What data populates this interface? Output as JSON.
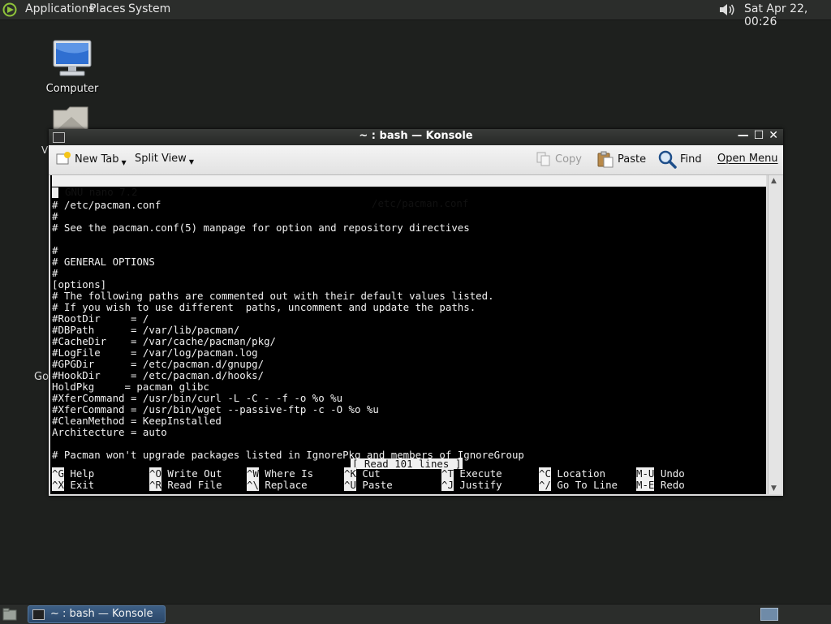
{
  "top_panel": {
    "menus": [
      "Applications",
      "Places",
      "System"
    ],
    "clock": "Sat Apr 22, 00:26"
  },
  "desktop": {
    "icons": [
      {
        "label": "Computer",
        "icon": "computer-icon"
      },
      {
        "label": "",
        "icon": "folder-icon"
      }
    ],
    "partial_labels": [
      "V",
      "Go"
    ]
  },
  "konsole": {
    "title": "~ : bash — Konsole",
    "toolbar": {
      "new_tab": "New Tab",
      "split_view": "Split View",
      "copy": "Copy",
      "paste": "Paste",
      "find": "Find",
      "open_menu": "Open Menu"
    },
    "nano": {
      "version": "GNU nano 7.2",
      "filename": "/etc/pacman.conf",
      "lines": [
        "#",
        "# /etc/pacman.conf",
        "#",
        "# See the pacman.conf(5) manpage for option and repository directives",
        "",
        "#",
        "# GENERAL OPTIONS",
        "#",
        "[options]",
        "# The following paths are commented out with their default values listed.",
        "# If you wish to use different  paths, uncomment and update the paths.",
        "#RootDir     = /",
        "#DBPath      = /var/lib/pacman/",
        "#CacheDir    = /var/cache/pacman/pkg/",
        "#LogFile     = /var/log/pacman.log",
        "#GPGDir      = /etc/pacman.d/gnupg/",
        "#HookDir     = /etc/pacman.d/hooks/",
        "HoldPkg     = pacman glibc",
        "#XferCommand = /usr/bin/curl -L -C - -f -o %o %u",
        "#XferCommand = /usr/bin/wget --passive-ftp -c -O %o %u",
        "#CleanMethod = KeepInstalled",
        "Architecture = auto",
        "",
        "# Pacman won't upgrade packages listed in IgnorePkg and members of IgnoreGroup"
      ],
      "status": "[ Read 101 lines ]",
      "shortcuts_row1": [
        {
          "key": "^G",
          "label": "Help"
        },
        {
          "key": "^O",
          "label": "Write Out"
        },
        {
          "key": "^W",
          "label": "Where Is"
        },
        {
          "key": "^K",
          "label": "Cut"
        },
        {
          "key": "^T",
          "label": "Execute"
        },
        {
          "key": "^C",
          "label": "Location"
        },
        {
          "key": "M-U",
          "label": "Undo"
        }
      ],
      "shortcuts_row2": [
        {
          "key": "^X",
          "label": "Exit"
        },
        {
          "key": "^R",
          "label": "Read File"
        },
        {
          "key": "^\\",
          "label": "Replace"
        },
        {
          "key": "^U",
          "label": "Paste"
        },
        {
          "key": "^J",
          "label": "Justify"
        },
        {
          "key": "^/",
          "label": "Go To Line"
        },
        {
          "key": "M-E",
          "label": "Redo"
        }
      ]
    }
  },
  "taskbar": {
    "task_label": "~ : bash — Konsole"
  }
}
